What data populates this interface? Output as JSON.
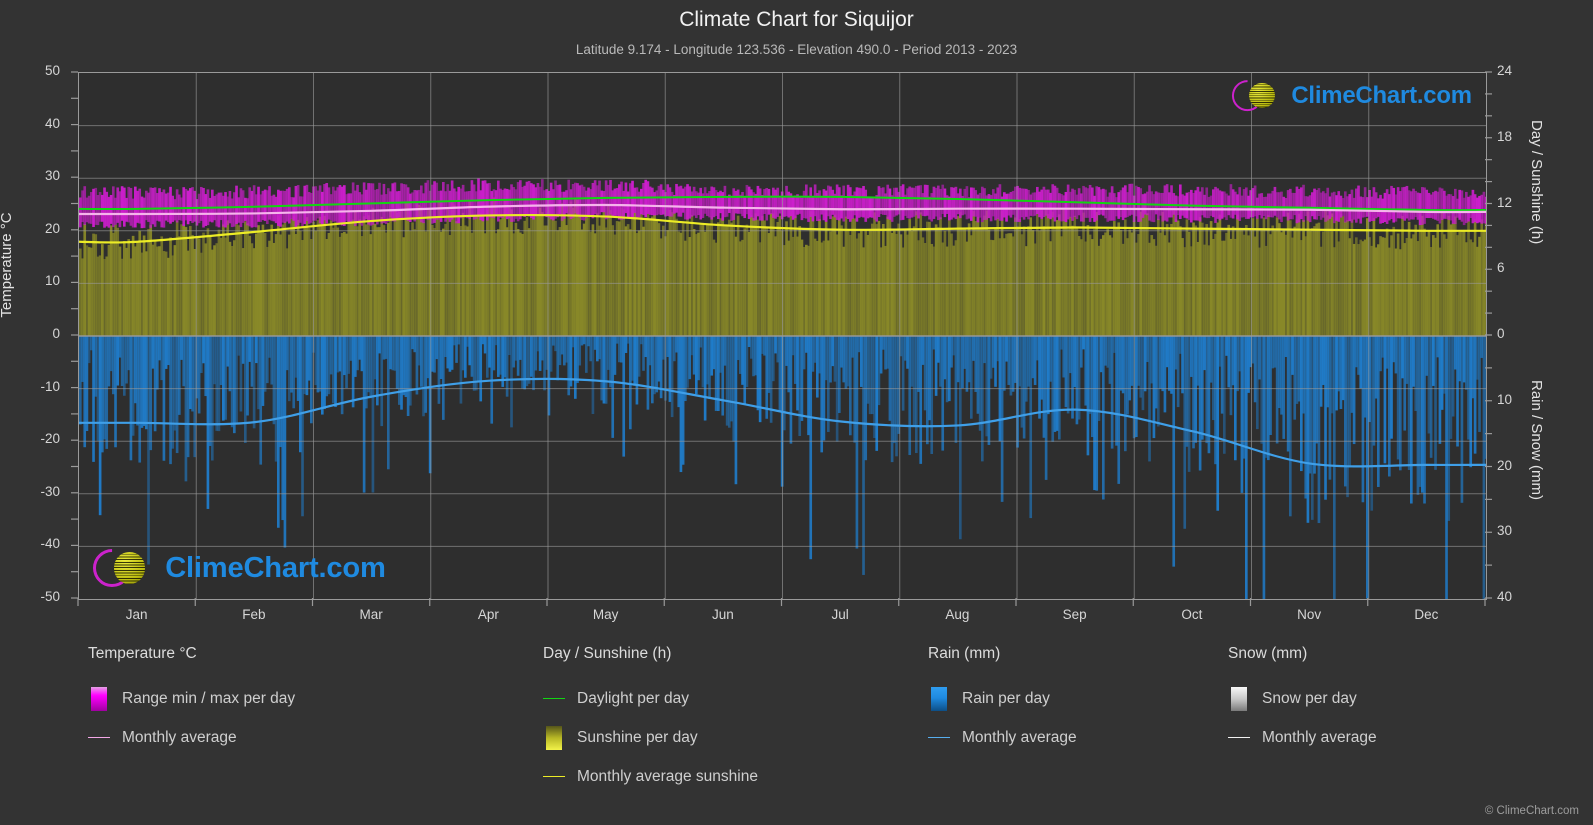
{
  "header": {
    "title": "Climate Chart for Siquijor",
    "subtitle": "Latitude 9.174 - Longitude 123.536 - Elevation 490.0 - Period 2013 - 2023"
  },
  "branding": {
    "logo_text": "ClimeChart.com",
    "copyright": "© ClimeChart.com"
  },
  "legend": {
    "columns": [
      {
        "heading": "Temperature °C",
        "items": [
          {
            "label": "Range min / max per day",
            "key": "swatch",
            "color": "#e000e0"
          },
          {
            "label": "Monthly average",
            "key": "line",
            "color": "#f4a8e8"
          }
        ]
      },
      {
        "heading": "Day / Sunshine (h)",
        "items": [
          {
            "label": "Daylight per day",
            "key": "line",
            "color": "#12d512"
          },
          {
            "label": "Sunshine per day",
            "key": "swatch",
            "color": "#e8e82c"
          },
          {
            "label": "Monthly average sunshine",
            "key": "line",
            "color": "#ecec26"
          }
        ]
      },
      {
        "heading": "Rain (mm)",
        "items": [
          {
            "label": "Rain per day",
            "key": "swatch",
            "color": "#1f8ae0"
          },
          {
            "label": "Monthly average",
            "key": "line",
            "color": "#57aeee"
          }
        ]
      },
      {
        "heading": "Snow (mm)",
        "items": [
          {
            "label": "Snow per day",
            "key": "swatch",
            "color": "#e8e8e8"
          },
          {
            "label": "Monthly average",
            "key": "line",
            "color": "#f2f2f2"
          }
        ]
      }
    ]
  },
  "chart_data": {
    "type": "area",
    "title": "Climate Chart for Siquijor",
    "subtitle": "Latitude 9.174 - Longitude 123.536 - Elevation 490.0 - Period 2013 - 2023",
    "xlabel": "",
    "categories": [
      "Jan",
      "Feb",
      "Mar",
      "Apr",
      "May",
      "Jun",
      "Jul",
      "Aug",
      "Sep",
      "Oct",
      "Nov",
      "Dec"
    ],
    "axes": {
      "left": {
        "label": "Temperature °C",
        "ticks": [
          50,
          40,
          30,
          20,
          10,
          0,
          -10,
          -20,
          -30,
          -40,
          -50
        ],
        "range": [
          -50,
          50
        ]
      },
      "right_upper": {
        "label": "Day / Sunshine (h)",
        "ticks": [
          24,
          18,
          12,
          6,
          0
        ],
        "range": [
          0,
          24
        ]
      },
      "right_lower": {
        "label": "Rain / Snow (mm)",
        "ticks": [
          0,
          10,
          20,
          30,
          40
        ],
        "range": [
          0,
          40
        ]
      }
    },
    "grid": true,
    "legend_position": "below",
    "series": [
      {
        "name": "Range min / max per day",
        "type": "band",
        "axis": "left",
        "unit": "°C",
        "color": "#e000e0",
        "min": [
          21.3,
          21.4,
          21.7,
          22.3,
          22.8,
          22.6,
          22.4,
          22.4,
          22.4,
          22.3,
          22.2,
          21.8
        ],
        "max": [
          27.2,
          27.4,
          28.0,
          28.8,
          28.6,
          27.8,
          27.5,
          27.6,
          27.7,
          27.6,
          27.5,
          27.3
        ]
      },
      {
        "name": "Monthly average",
        "type": "line",
        "axis": "left",
        "unit": "°C",
        "color": "#f4a8e8",
        "values": [
          23.2,
          23.3,
          23.8,
          24.6,
          24.9,
          24.4,
          24.1,
          24.2,
          24.2,
          24.1,
          24.0,
          23.6
        ]
      },
      {
        "name": "Daylight per day",
        "type": "line",
        "axis": "right_upper",
        "unit": "h",
        "color": "#12d512",
        "values": [
          11.6,
          11.8,
          12.1,
          12.4,
          12.6,
          12.7,
          12.7,
          12.5,
          12.2,
          11.9,
          11.7,
          11.5
        ]
      },
      {
        "name": "Sunshine per day",
        "type": "bars",
        "axis": "right_upper",
        "unit": "h",
        "color": "#8a8a28",
        "values": [
          8.6,
          9.5,
          10.5,
          11.0,
          10.9,
          10.1,
          9.7,
          9.8,
          9.9,
          9.8,
          9.7,
          9.6
        ]
      },
      {
        "name": "Monthly average sunshine",
        "type": "line",
        "axis": "right_upper",
        "unit": "h",
        "color": "#ecec26",
        "values": [
          8.6,
          9.5,
          10.5,
          11.0,
          10.9,
          10.1,
          9.7,
          9.8,
          9.9,
          9.8,
          9.7,
          9.6
        ]
      },
      {
        "name": "Rain monthly average",
        "type": "line",
        "axis": "right_lower",
        "unit": "mm",
        "color": "#57aeee",
        "values": [
          13.2,
          13.1,
          9.2,
          6.8,
          6.9,
          9.8,
          13.0,
          13.6,
          11.2,
          14.5,
          19.4,
          19.6
        ]
      },
      {
        "name": "Rain per day",
        "type": "bars",
        "axis": "right_lower",
        "unit": "mm",
        "color": "#1f8ae0",
        "values": [
          13.2,
          13.1,
          9.2,
          6.8,
          6.9,
          9.8,
          13.0,
          13.6,
          11.2,
          14.5,
          19.4,
          19.6
        ]
      },
      {
        "name": "Snow per day",
        "type": "bars",
        "axis": "right_lower",
        "unit": "mm",
        "color": "#e8e8e8",
        "values": [
          0,
          0,
          0,
          0,
          0,
          0,
          0,
          0,
          0,
          0,
          0,
          0
        ]
      }
    ]
  }
}
